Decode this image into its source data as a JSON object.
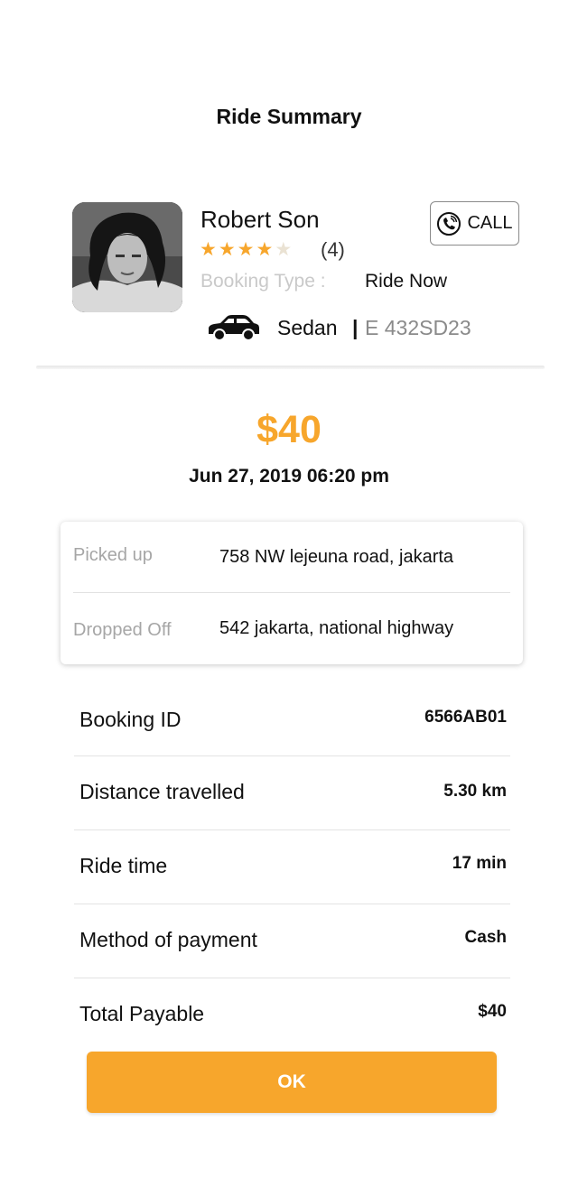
{
  "header": {
    "title": "Ride Summary"
  },
  "driver": {
    "name": "Robert Son",
    "rating_stars": 4,
    "rating_max": 5,
    "rating_count": "(4)",
    "booking_type_label": "Booking Type :",
    "booking_type_value": "Ride Now",
    "vehicle_model": "Sedan",
    "vehicle_separator": "|",
    "vehicle_plate": "E 432SD23",
    "call_label": "CALL"
  },
  "fare": {
    "amount": "$40",
    "datetime": "Jun 27, 2019 06:20 pm"
  },
  "locations": {
    "pickup_label": "Picked up",
    "pickup_value": "758 NW lejeuna road, jakarta",
    "dropoff_label": "Dropped Off",
    "dropoff_value": "542 jakarta, national highway"
  },
  "details": [
    {
      "label": "Booking ID",
      "value": "6566AB01"
    },
    {
      "label": "Distance travelled",
      "value": "5.30 km"
    },
    {
      "label": "Ride time",
      "value": "17 min"
    },
    {
      "label": "Method of payment",
      "value": "Cash"
    },
    {
      "label": "Total Payable",
      "value": "$40"
    }
  ],
  "actions": {
    "ok_label": "OK"
  },
  "colors": {
    "accent": "#f7a62c",
    "muted": "#a6a6a6",
    "star_off": "#eae2d3"
  }
}
